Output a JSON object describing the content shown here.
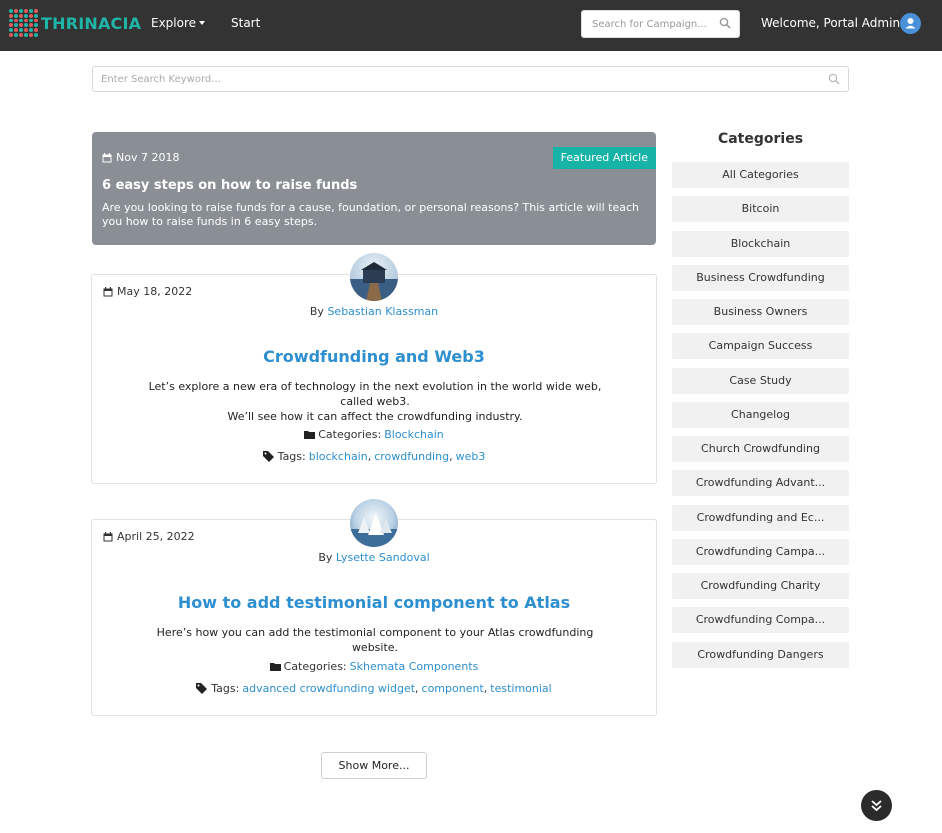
{
  "navbar": {
    "logo_text": "THRINACIA",
    "explore_label": "Explore",
    "start_label": "Start",
    "search_placeholder": "Search for Campaign...",
    "welcome_text": "Welcome, Portal Admin!"
  },
  "search": {
    "placeholder": "Enter Search Keyword..."
  },
  "featured": {
    "date": "Nov 7 2018",
    "badge": "Featured Article",
    "title": "6 easy steps on how to raise funds",
    "description": "Are you looking to raise funds for a cause, foundation, or personal reasons? This article will teach you how to raise funds in 6 easy steps."
  },
  "articles": [
    {
      "date": "May 18, 2022",
      "by": "By",
      "author": "Sebastian Klassman",
      "title": "Crowdfunding and Web3",
      "description_line1": "Let’s explore a new era of technology in the next evolution in the world wide web, called web3.",
      "description_line2": "We’ll see how it can affect the crowdfunding industry.",
      "categories_label": "Categories:",
      "category": "Blockchain",
      "tags_label": "Tags:",
      "tags": [
        "blockchain",
        "crowdfunding",
        "web3"
      ]
    },
    {
      "date": "April 25, 2022",
      "by": "By",
      "author": "Lysette Sandoval",
      "title": "How to add testimonial component to Atlas",
      "description_line1": "Here’s how you can add the testimonial component to your Atlas crowdfunding website.",
      "categories_label": "Categories:",
      "category": "Skhemata Components",
      "tags_label": "Tags:",
      "tags": [
        "advanced crowdfunding widget",
        "component",
        "testimonial"
      ]
    }
  ],
  "show_more_label": "Show More...",
  "sidebar": {
    "title": "Categories",
    "items": [
      "All Categories",
      "Bitcoin",
      "Blockchain",
      "Business Crowdfunding",
      "Business Owners",
      "Campaign Success",
      "Case Study",
      "Changelog",
      "Church Crowdfunding",
      "Crowdfunding Advant...",
      "Crowdfunding and Ec...",
      "Crowdfunding Campa...",
      "Crowdfunding Charity",
      "Crowdfunding Compa...",
      "Crowdfunding Dangers"
    ]
  },
  "colors": {
    "navbar_bg": "#333333",
    "accent_teal": "#16b3a6",
    "link_blue": "#2e8fd0",
    "featured_bg": "#8a8f96"
  },
  "icons": [
    "search-icon",
    "calendar-icon",
    "folder-icon",
    "tags-icon",
    "user-icon",
    "chevron-double-down-icon"
  ]
}
